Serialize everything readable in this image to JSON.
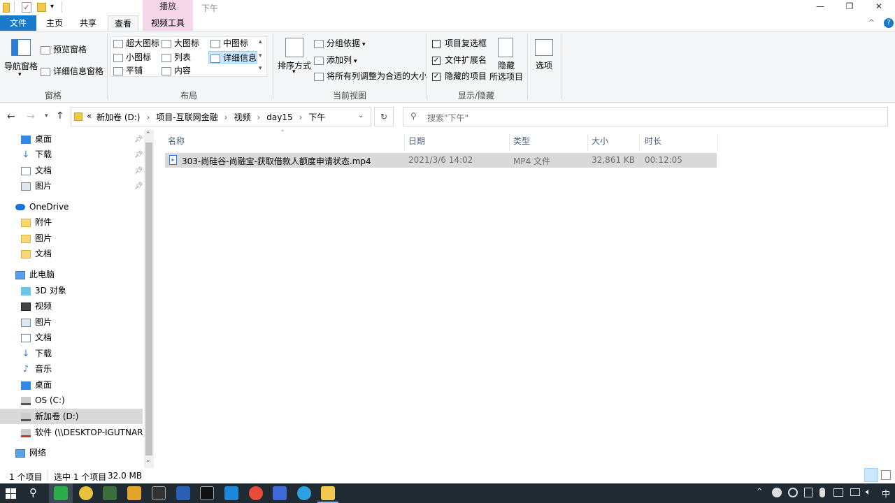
{
  "titlebar": {
    "context_tab": "播放",
    "window_title": "下午",
    "minimize": "—",
    "restore": "❐",
    "close": "✕"
  },
  "tabs": {
    "file": "文件",
    "home": "主页",
    "share": "共享",
    "view": "查看",
    "video_tools": "视频工具"
  },
  "ribbon": {
    "panes": {
      "nav_pane": "导航窗格",
      "preview_pane": "预览窗格",
      "details_pane": "详细信息窗格",
      "label": "窗格"
    },
    "layout": {
      "extra_large": "超大图标",
      "large": "大图标",
      "medium": "中图标",
      "small": "小图标",
      "list": "列表",
      "details": "详细信息",
      "tiles": "平铺",
      "content": "内容",
      "label": "布局"
    },
    "current_view": {
      "sort_by": "排序方式",
      "group_by": "分组依据",
      "add_columns": "添加列",
      "size_all_columns": "将所有列调整为合适的大小",
      "label": "当前视图"
    },
    "show_hide": {
      "item_checkboxes": "项目复选框",
      "item_checkboxes_checked": false,
      "file_extensions": "文件扩展名",
      "file_extensions_checked": true,
      "hidden_items": "隐藏的项目",
      "hidden_items_checked": true,
      "hide_selected_1": "隐藏",
      "hide_selected_2": "所选项目",
      "label": "显示/隐藏"
    },
    "options": "选项"
  },
  "address": {
    "overflow": "«",
    "crumbs": [
      "新加卷 (D:)",
      "项目-互联网金融",
      "视频",
      "day15",
      "下午"
    ],
    "search_placeholder": "搜索\"下午\""
  },
  "nav": {
    "quick_access": [
      {
        "label": "桌面",
        "pinned": true
      },
      {
        "label": "下载",
        "pinned": true
      },
      {
        "label": "文档",
        "pinned": true
      },
      {
        "label": "图片",
        "pinned": true
      }
    ],
    "onedrive": "OneDrive",
    "onedrive_items": [
      "附件",
      "图片",
      "文档"
    ],
    "this_pc": "此电脑",
    "pc_items": [
      "3D 对象",
      "视频",
      "图片",
      "文档",
      "下载",
      "音乐",
      "桌面",
      "OS (C:)",
      "新加卷 (D:)",
      "软件 (\\\\DESKTOP-IGUTNAR)"
    ],
    "network": "网络"
  },
  "columns": {
    "name": "名称",
    "date": "日期",
    "type": "类型",
    "size": "大小",
    "duration": "时长"
  },
  "files": [
    {
      "name": "303-尚硅谷-尚融宝-获取借款人额度申请状态.mp4",
      "date": "2021/3/6 14:02",
      "type": "MP4 文件",
      "size": "32,861 KB",
      "duration": "00:12:05"
    }
  ],
  "status": {
    "count": "1 个项目",
    "selected": "选中 1 个项目",
    "selected_size": "32.0 MB"
  },
  "colors": {
    "file_tab": "#1979ca",
    "context_tab": "#f6d6e9",
    "selected_row": "#d9d9d9",
    "taskbar": "#1f2a33"
  }
}
